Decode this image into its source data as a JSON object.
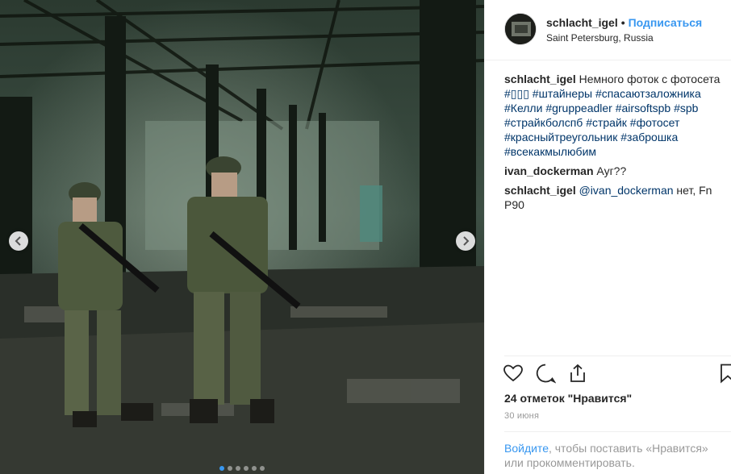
{
  "post": {
    "username": "schlacht_igel",
    "separator": "•",
    "follow_label": "Подписаться",
    "location": "Saint Petersburg, Russia"
  },
  "photo": {
    "carousel_dots": 6,
    "active_dot": 0
  },
  "comments": [
    {
      "author": "schlacht_igel",
      "text": "Немного фоток с фотосета",
      "hashtags": [
        "#▯▯▯",
        "#штайнеры",
        "#спасаютзаложника",
        "#Келли",
        "#gruppeadler",
        "#airsoftspb",
        "#spb",
        "#страйкболспб",
        "#страйк",
        "#фотосет",
        "#красныйтреугольник",
        "#заброшка",
        "#всекакмылюбим"
      ]
    },
    {
      "author": "ivan_dockerman",
      "text": "Ауг??"
    },
    {
      "author": "schlacht_igel",
      "mention": "@ivan_dockerman",
      "text": "нет, Fn P90"
    }
  ],
  "actions": {
    "like_icon": "heart-icon",
    "comment_icon": "comment-bubble-icon",
    "share_icon": "share-icon",
    "save_icon": "bookmark-icon"
  },
  "likes_text": "24 отметок \"Нравится\"",
  "date_text": "30 июня",
  "login_prompt": {
    "link": "Войдите",
    "rest": ", чтобы поставить «Нравится» или прокомментировать."
  },
  "colors": {
    "accent": "#3897f0",
    "hashtag": "#003569",
    "muted": "#999999"
  }
}
